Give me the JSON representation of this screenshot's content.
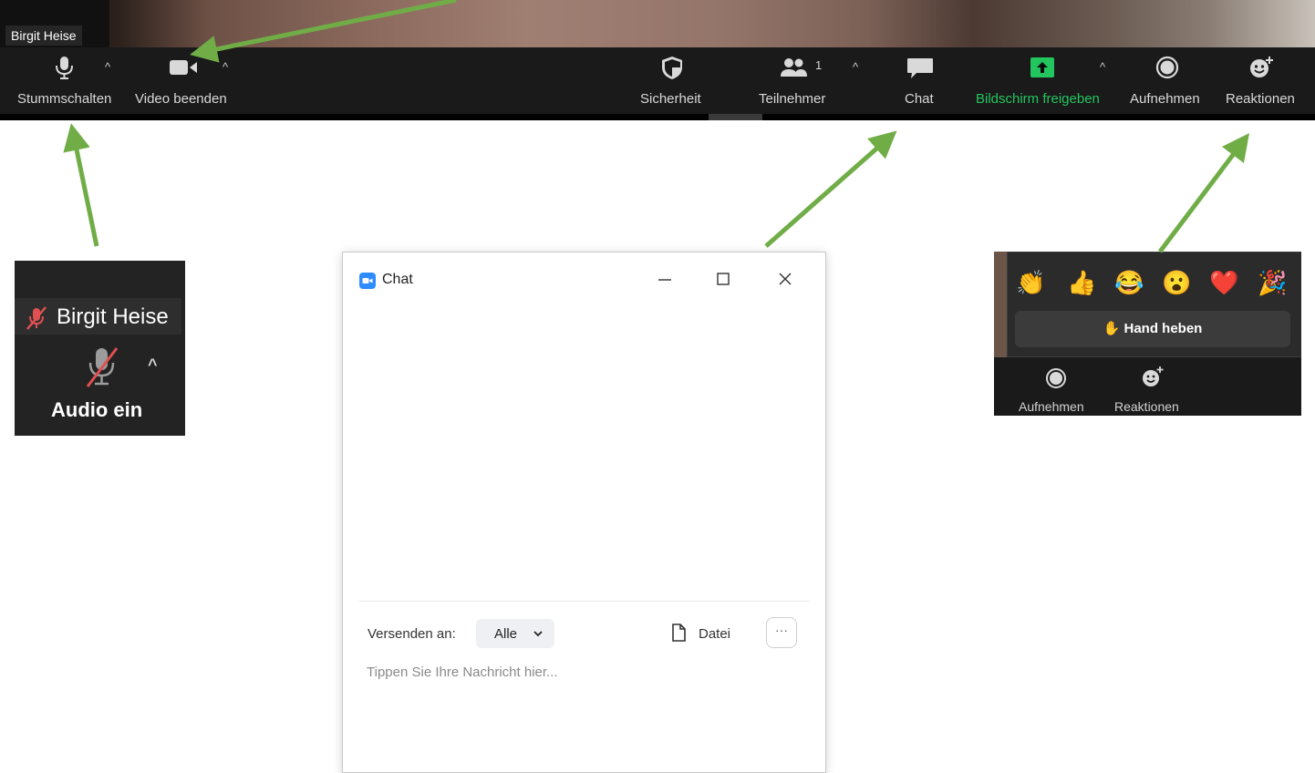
{
  "video": {
    "participant_name": "Birgit Heise"
  },
  "toolbar": {
    "mute_label": "Stummschalten",
    "video_label": "Video beenden",
    "security_label": "Sicherheit",
    "participants_label": "Teilnehmer",
    "participants_count": "1",
    "chat_label": "Chat",
    "share_label": "Bildschirm freigeben",
    "record_label": "Aufnehmen",
    "reactions_label": "Reaktionen",
    "caret": "^"
  },
  "audio_inset": {
    "name": "Birgit Heise",
    "audio_label": "Audio ein",
    "caret": "^"
  },
  "chat_window": {
    "title": "Chat",
    "send_to_label": "Versenden an:",
    "recipient": "Alle",
    "file_label": "Datei",
    "more": "···",
    "message_placeholder": "Tippen Sie Ihre Nachricht hier..."
  },
  "reactions_inset": {
    "emojis": [
      "👏",
      "👍",
      "😂",
      "😮",
      "❤️",
      "🎉"
    ],
    "raise_hand_icon": "✋",
    "raise_hand_label": "Hand heben",
    "record_label": "Aufnehmen",
    "reactions_label": "Reaktionen"
  },
  "colors": {
    "toolbar_bg": "#1a1a1a",
    "share_green": "#22c55e",
    "arrow_green": "#70ad47",
    "chat_icon_blue": "#2d8cff"
  },
  "icons": [
    "microphone-icon",
    "video-camera-icon",
    "shield-icon",
    "participants-icon",
    "chat-bubble-icon",
    "share-screen-icon",
    "record-icon",
    "reaction-add-icon",
    "muted-microphone-icon",
    "zoom-logo-icon",
    "file-icon"
  ]
}
